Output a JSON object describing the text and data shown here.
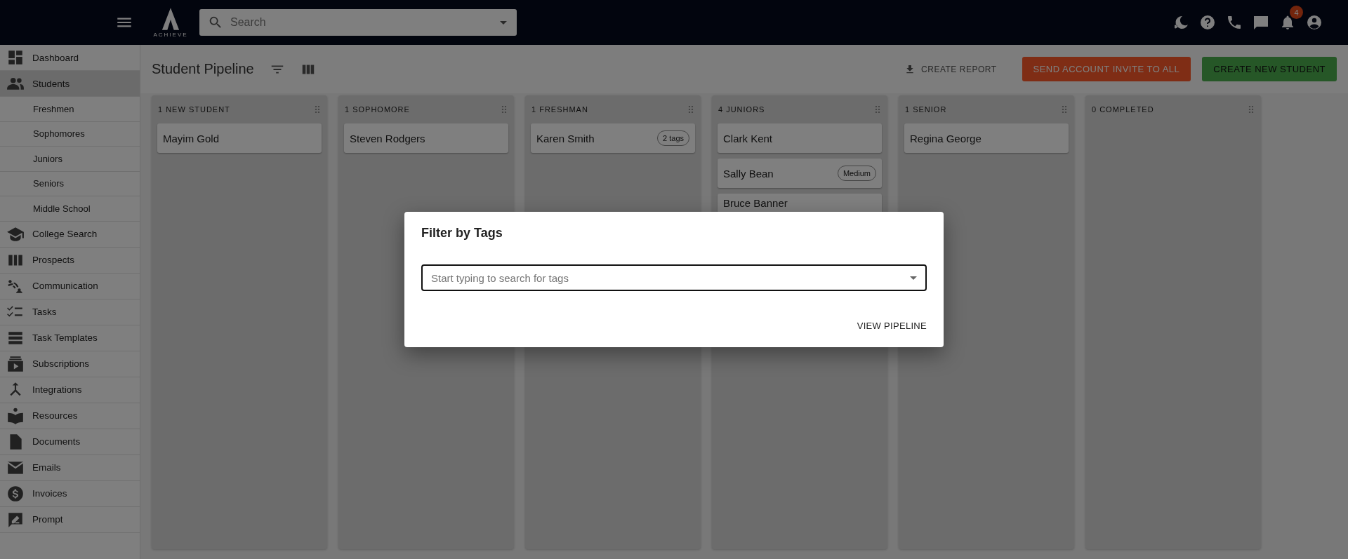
{
  "topbar": {
    "logo_text": "ACHIEVE",
    "search": {
      "placeholder": "Search"
    },
    "notification_count": "4"
  },
  "sidebar": {
    "items": [
      {
        "label": "Dashboard",
        "selected": false
      },
      {
        "label": "Students",
        "selected": true,
        "children": [
          {
            "label": "Freshmen",
            "selected": false
          },
          {
            "label": "Sophomores",
            "selected": false
          },
          {
            "label": "Juniors",
            "selected": false
          },
          {
            "label": "Seniors",
            "selected": false
          },
          {
            "label": "Middle School",
            "selected": false
          }
        ]
      },
      {
        "label": "College Search",
        "selected": false
      },
      {
        "label": "Prospects",
        "selected": false
      },
      {
        "label": "Communication",
        "selected": false
      },
      {
        "label": "Tasks",
        "selected": false
      },
      {
        "label": "Task Templates",
        "selected": false
      },
      {
        "label": "Subscriptions",
        "selected": false
      },
      {
        "label": "Integrations",
        "selected": false
      },
      {
        "label": "Resources",
        "selected": false
      },
      {
        "label": "Documents",
        "selected": false
      },
      {
        "label": "Emails",
        "selected": false
      },
      {
        "label": "Invoices",
        "selected": false
      },
      {
        "label": "Prompt",
        "selected": false
      }
    ]
  },
  "page": {
    "title": "Student Pipeline",
    "actions": [
      {
        "label": "CREATE REPORT",
        "kind": "text"
      },
      {
        "label": "SEND ACCOUNT INVITE TO ALL",
        "kind": "orange"
      },
      {
        "label": "CREATE NEW STUDENT",
        "kind": "green"
      }
    ]
  },
  "columns": [
    {
      "title": "1 NEW STUDENT",
      "cards": [
        {
          "name": "Mayim Gold"
        }
      ]
    },
    {
      "title": "1 SOPHOMORE",
      "cards": [
        {
          "name": "Steven Rodgers"
        }
      ]
    },
    {
      "title": "1 FRESHMAN",
      "cards": [
        {
          "name": "Karen Smith",
          "tag": "2 tags"
        }
      ]
    },
    {
      "title": "4 JUNIORS",
      "cards": [
        {
          "name": "Clark Kent"
        },
        {
          "name": "Sally Bean",
          "tag": "Medium"
        },
        {
          "name": "Bruce Banner"
        }
      ]
    },
    {
      "title": "1 SENIOR",
      "cards": [
        {
          "name": "Regina George"
        }
      ]
    },
    {
      "title": "0 COMPLETED"
    }
  ],
  "dialog": {
    "title": "Filter by Tags",
    "field": {
      "placeholder": "Start typing to search for tags"
    },
    "button": "VIEW PIPELINE"
  }
}
